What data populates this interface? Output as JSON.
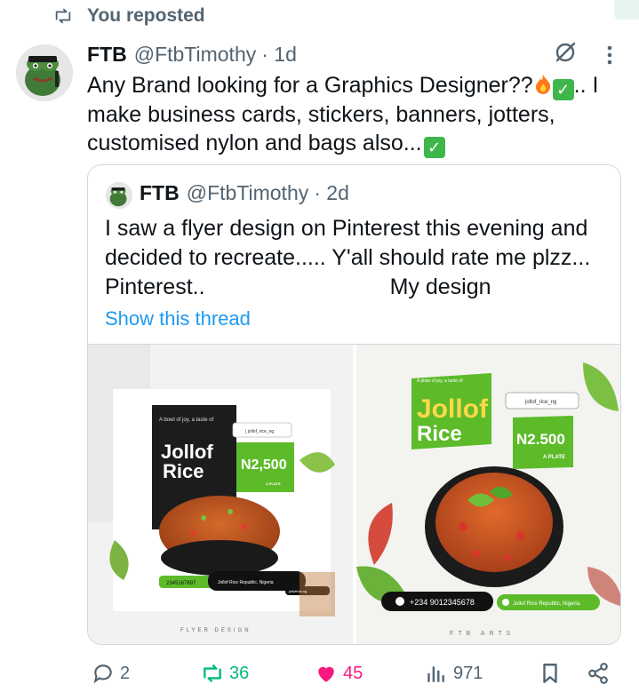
{
  "repost_banner": {
    "text": "You reposted"
  },
  "post": {
    "name": "FTB",
    "handle": "@FtbTimothy",
    "time": "· 1d",
    "text_part1": "Any Brand looking for a Graphics Designer??",
    "text_part2": ".. I make business cards, stickers, banners, jotters, customised nylon and bags also...",
    "quote": {
      "name": "FTB",
      "handle": "@FtbTimothy",
      "time": "· 2d",
      "text_line1": "I saw a flyer design on Pinterest this evening and decided to recreate..... Y'all should rate me plzz...",
      "text_line3_left": "Pinterest..",
      "text_line3_right": "My design",
      "show_thread": "Show this thread",
      "image1": {
        "tagline": "A bowl of joy, a taste of",
        "title1": "Jollof",
        "title2": "Rice",
        "social": "| jollof_rice_ng",
        "price": "N2,500",
        "price_sub": "A PLATE",
        "phone": "2345167897",
        "address": "Jollof Rice Republic, Nigeria",
        "website": "jollofrice.ng",
        "footer": "FLYER DESIGN"
      },
      "image2": {
        "tagline": "A plate of joy, a taste of",
        "title1": "Jollof",
        "title2": "Rice",
        "social": "jollof_rice_ng",
        "price": "N2.500",
        "price_sub": "A PLATE",
        "phone": "+234 9012345678",
        "address": "Jollof Rice Republic, Nigeria.",
        "footer": "FTB ARTS"
      }
    }
  },
  "actions": {
    "replies": "2",
    "reposts": "36",
    "likes": "45",
    "views": "971"
  },
  "colors": {
    "accent": "#1d9bf0",
    "repost_green": "#00ba7c",
    "like_pink": "#f91880",
    "muted": "#536471",
    "flyer_green": "#5dbb2a"
  }
}
